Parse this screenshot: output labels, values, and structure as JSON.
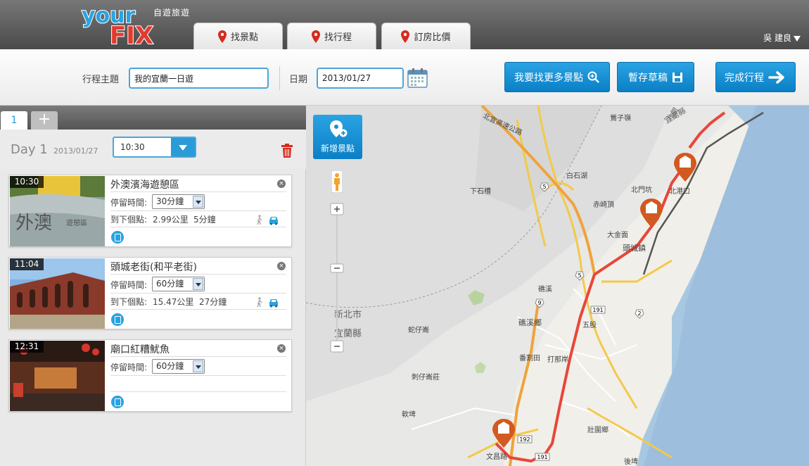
{
  "brand": {
    "logo_text": "yourFix",
    "subtitle": "自遊旅遊"
  },
  "nav": {
    "tabs": [
      {
        "label": "找景點"
      },
      {
        "label": "找行程"
      },
      {
        "label": "訂房比價"
      }
    ],
    "user_name": "吳 建良"
  },
  "toolbar": {
    "theme_label": "行程主題",
    "theme_value": "我的宜蘭一日遊",
    "date_label": "日期",
    "date_value": "2013/01/27",
    "find_more_label": "我要找更多景點",
    "save_draft_label": "暫存草稿",
    "finish_label": "完成行程"
  },
  "day_tabs": {
    "active": "1",
    "add": "+"
  },
  "day": {
    "title": "Day 1",
    "date": "2013/01/27",
    "start_time": "10:30"
  },
  "itinerary": [
    {
      "time": "10:30",
      "name": "外澳濱海遊憩區",
      "stay_label": "停留時間:",
      "stay_value": "30分鐘",
      "next_label": "到下個點:",
      "next_distance": "2.99公里",
      "next_duration": "5分鐘"
    },
    {
      "time": "11:04",
      "name": "頭城老街(和平老街)",
      "stay_label": "停留時間:",
      "stay_value": "60分鐘",
      "next_label": "到下個點:",
      "next_distance": "15.47公里",
      "next_duration": "27分鐘"
    },
    {
      "time": "12:31",
      "name": "廟口紅糟魷魚",
      "stay_label": "停留時間:",
      "stay_value": "60分鐘"
    }
  ],
  "map": {
    "add_spot_label": "新增景點",
    "labels": {
      "l1": "鶯子嶺",
      "l2": "北關",
      "l3": "北港口",
      "l4": "北門坑",
      "l5": "白石湖",
      "l6": "下石槽",
      "l7": "赤崎頂",
      "l8": "大金面",
      "l9": "頭城鎮",
      "l10": "礁溪",
      "l11": "礁溪鄉",
      "l12": "五股",
      "l13": "番割田",
      "l14": "打那岸",
      "l15": "蛇仔崙",
      "l16": "刺仔崙莊",
      "l17": "軟埤",
      "l18": "壯圍鄉",
      "l19": "後埤",
      "l20": "文昌路",
      "l21": "新北市",
      "l22": "宜蘭縣",
      "l23": "宜蘭縣",
      "l24": "北宜高速公路"
    },
    "route_color": "#e8463a",
    "road_color": "#f3c94a"
  },
  "colors": {
    "accent": "#1a8fd2",
    "delete": "#d62b20"
  }
}
